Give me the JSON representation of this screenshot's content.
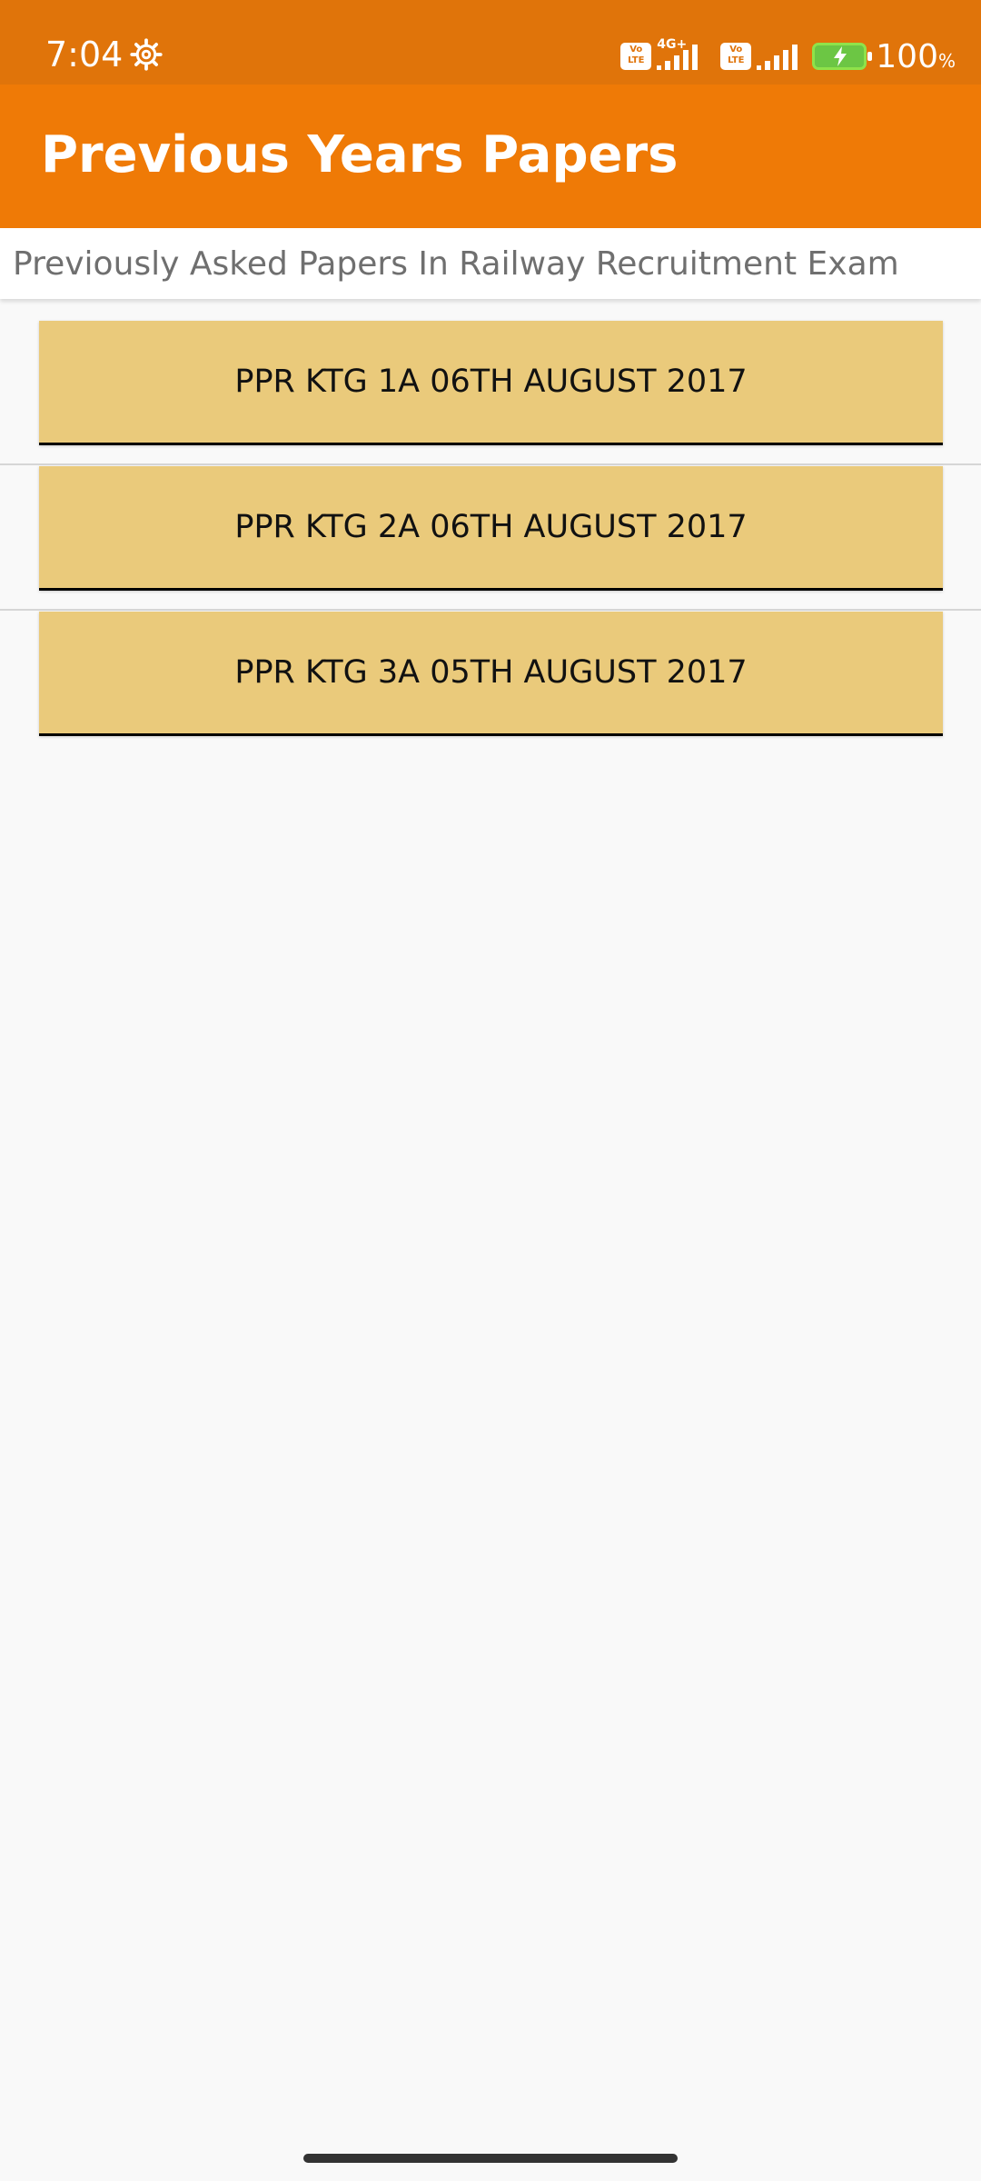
{
  "status_bar": {
    "time": "7:04",
    "network_label": "4G+",
    "volte_label": "Vo LTE",
    "battery_percent": "100",
    "battery_unit": "%"
  },
  "app_bar": {
    "title": "Previous Years Papers"
  },
  "subtitle": "Previously Asked Papers In Railway Recruitment Exam",
  "papers": [
    {
      "label": "PPR KTG 1A 06TH AUGUST 2017"
    },
    {
      "label": "PPR KTG 2A 06TH AUGUST 2017"
    },
    {
      "label": "PPR KTG 3A 05TH AUGUST 2017"
    }
  ],
  "colors": {
    "status_bar": "#e0740a",
    "app_bar": "#ef7a06",
    "button": "#eaca7b",
    "background": "#f9f9f9"
  }
}
